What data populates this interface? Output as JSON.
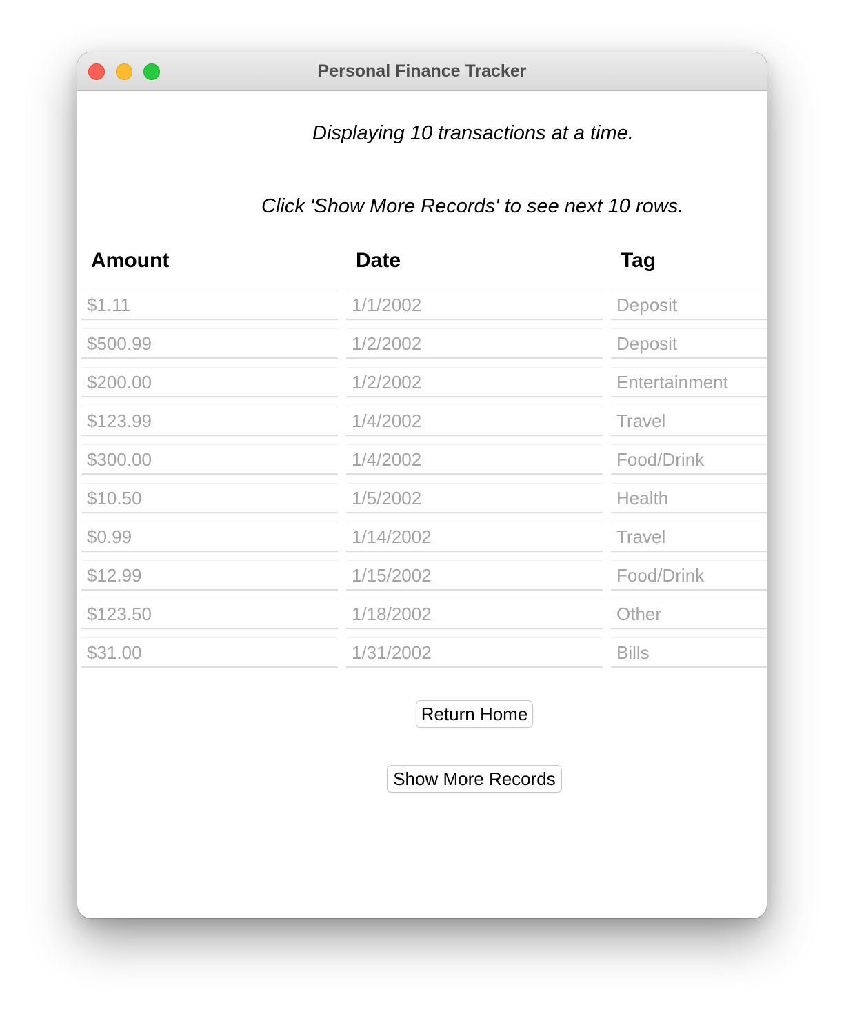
{
  "window": {
    "title": "Personal Finance Tracker"
  },
  "info": {
    "line1": "Displaying 10 transactions at a time.",
    "line2": "Click 'Show More Records' to see next 10 rows."
  },
  "table": {
    "columns": [
      "Amount",
      "Date",
      "Tag"
    ],
    "rows": [
      {
        "amount": "$1.11",
        "date": "1/1/2002",
        "tag": "Deposit"
      },
      {
        "amount": "$500.99",
        "date": "1/2/2002",
        "tag": "Deposit"
      },
      {
        "amount": "$200.00",
        "date": "1/2/2002",
        "tag": "Entertainment"
      },
      {
        "amount": "$123.99",
        "date": "1/4/2002",
        "tag": "Travel"
      },
      {
        "amount": "$300.00",
        "date": "1/4/2002",
        "tag": "Food/Drink"
      },
      {
        "amount": "$10.50",
        "date": "1/5/2002",
        "tag": "Health"
      },
      {
        "amount": "$0.99",
        "date": "1/14/2002",
        "tag": "Travel"
      },
      {
        "amount": "$12.99",
        "date": "1/15/2002",
        "tag": "Food/Drink"
      },
      {
        "amount": "$123.50",
        "date": "1/18/2002",
        "tag": "Other"
      },
      {
        "amount": "$31.00",
        "date": "1/31/2002",
        "tag": "Bills"
      }
    ]
  },
  "buttons": {
    "return_home": "Return Home",
    "show_more": "Show More Records"
  },
  "colors": {
    "close": "#fe5f57",
    "minimize": "#febc2e",
    "zoom": "#28c840",
    "cell_text": "#a3a3a3"
  }
}
